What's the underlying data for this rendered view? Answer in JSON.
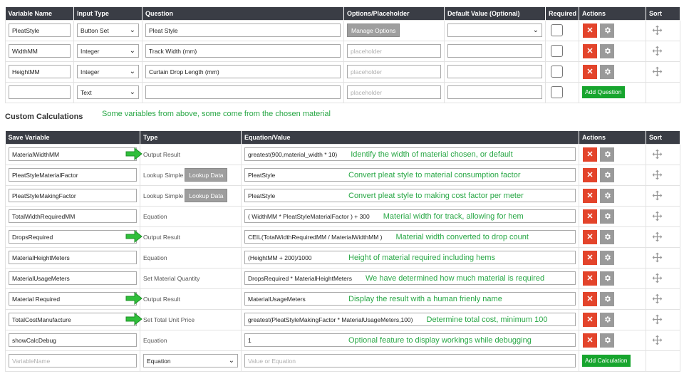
{
  "questions": {
    "headers": [
      "Variable Name",
      "Input Type",
      "Question",
      "Options/Placeholder",
      "Default Value (Optional)",
      "Required",
      "Actions",
      "Sort"
    ],
    "rows": [
      {
        "var": "PleatStyle",
        "type": "Button Set",
        "question": "Pleat Style",
        "options_button": "Manage Options",
        "placeholder": ""
      },
      {
        "var": "WidthMM",
        "type": "Integer",
        "question": "Track Width (mm)",
        "options_button": "",
        "placeholder": "placeholder"
      },
      {
        "var": "HeightMM",
        "type": "Integer",
        "question": "Curtain Drop Length (mm)",
        "options_button": "",
        "placeholder": "placeholder"
      }
    ],
    "new_row": {
      "var": "",
      "type": "Text",
      "question": "",
      "placeholder": "placeholder",
      "add_label": "Add Question"
    }
  },
  "section": {
    "title": "Custom Calculations",
    "note": "Some variables from above, some come from the chosen material"
  },
  "calculations": {
    "headers": [
      "Save Variable",
      "Type",
      "Equation/Value",
      "Actions",
      "Sort"
    ],
    "rows": [
      {
        "var": "MaterialWidthMM",
        "type": "Output Result",
        "lookup": "",
        "eq": "greatest(900,material_width * 10)",
        "note": "Identify the width of material chosen, or default",
        "arrow": true
      },
      {
        "var": "PleatStyleMaterialFactor",
        "type": "Lookup Simple",
        "lookup": "Lookup Data",
        "eq": "PleatStyle",
        "note": "Convert pleat style to material consumption factor",
        "arrow": false
      },
      {
        "var": "PleatStyleMakingFactor",
        "type": "Lookup Simple",
        "lookup": "Lookup Data",
        "eq": "PleatStyle",
        "note": "Convert pleat style to making cost factor per meter",
        "arrow": false
      },
      {
        "var": "TotalWidthRequiredMM",
        "type": "Equation",
        "lookup": "",
        "eq": "( WidthMM * PleatStyleMaterialFactor ) + 300",
        "note": "Material width for track, allowing for hem",
        "arrow": false
      },
      {
        "var": "DropsRequired",
        "type": "Output Result",
        "lookup": "",
        "eq": "CEIL(TotalWidthRequiredMM / MaterialWidthMM )",
        "note": "Material width converted to drop count",
        "arrow": true
      },
      {
        "var": "MaterialHeightMeters",
        "type": "Equation",
        "lookup": "",
        "eq": "(HeightMM + 200)/1000",
        "note": "Height of material required including hems",
        "arrow": false
      },
      {
        "var": "MaterialUsageMeters",
        "type": "Set Material Quantity",
        "lookup": "",
        "eq": "DropsRequired * MaterialHeightMeters",
        "note": "We have determined how much material is required",
        "arrow": false
      },
      {
        "var": "Material Required",
        "type": "Output Result",
        "lookup": "",
        "eq": "MaterialUsageMeters",
        "note": "Display the result with a human frienly name",
        "arrow": true
      },
      {
        "var": "TotalCostManufacture",
        "type": "Set Total Unit Price",
        "lookup": "",
        "eq": "greatest(PleatStyleMakingFactor * MaterialUsageMeters,100)",
        "note": "Determine total cost, minimum 100",
        "arrow": true
      },
      {
        "var": "showCalcDebug",
        "type": "Equation",
        "lookup": "",
        "eq": "1",
        "note": "Optional feature to display workings while debugging",
        "arrow": false
      }
    ],
    "new_row": {
      "var_placeholder": "VariableName",
      "type": "Equation",
      "eq_placeholder": "Value or Equation",
      "add_label": "Add Calculation"
    }
  },
  "icons": {
    "delete": "close-icon",
    "settings": "gear-icon",
    "sort": "move-icon",
    "arrow": "arrow-right-icon",
    "chevron": "chevron-down-icon"
  },
  "colors": {
    "header": "#3a3d45",
    "delete": "#e3442b",
    "settings": "#9a9a9a",
    "add": "#17a52e",
    "annotation": "#28a745"
  }
}
